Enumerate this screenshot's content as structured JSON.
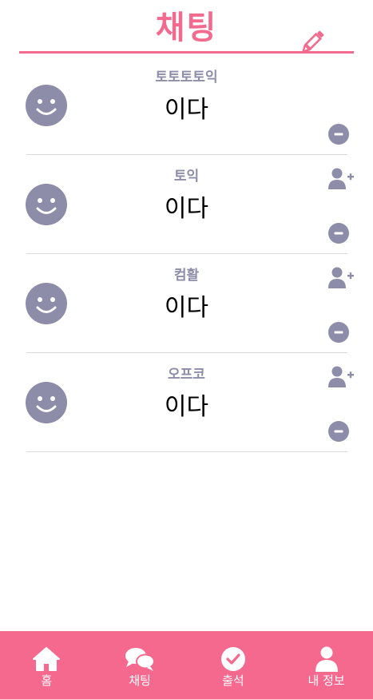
{
  "header": {
    "title": "채팅",
    "edit_icon": "pencil-icon",
    "accent_color": "#f26b8f"
  },
  "chats": [
    {
      "name": "토토토토익",
      "message": "이다",
      "avatar_icon": "smiley-icon",
      "add_friend": false
    },
    {
      "name": "토익",
      "message": "이다",
      "avatar_icon": "smiley-icon",
      "add_friend": true
    },
    {
      "name": "컴활",
      "message": "이다",
      "avatar_icon": "smiley-icon",
      "add_friend": true
    },
    {
      "name": "오프코",
      "message": "이다",
      "avatar_icon": "smiley-icon",
      "add_friend": true
    }
  ],
  "nav": {
    "background": "#f6698f",
    "items": [
      {
        "label": "홈",
        "icon": "home-icon"
      },
      {
        "label": "채팅",
        "icon": "chat-bubbles-icon"
      },
      {
        "label": "출석",
        "icon": "check-circle-icon"
      },
      {
        "label": "내 정보",
        "icon": "user-icon"
      }
    ]
  },
  "colors": {
    "icon_gray": "#8e8da9",
    "divider": "#d9d9d9"
  }
}
